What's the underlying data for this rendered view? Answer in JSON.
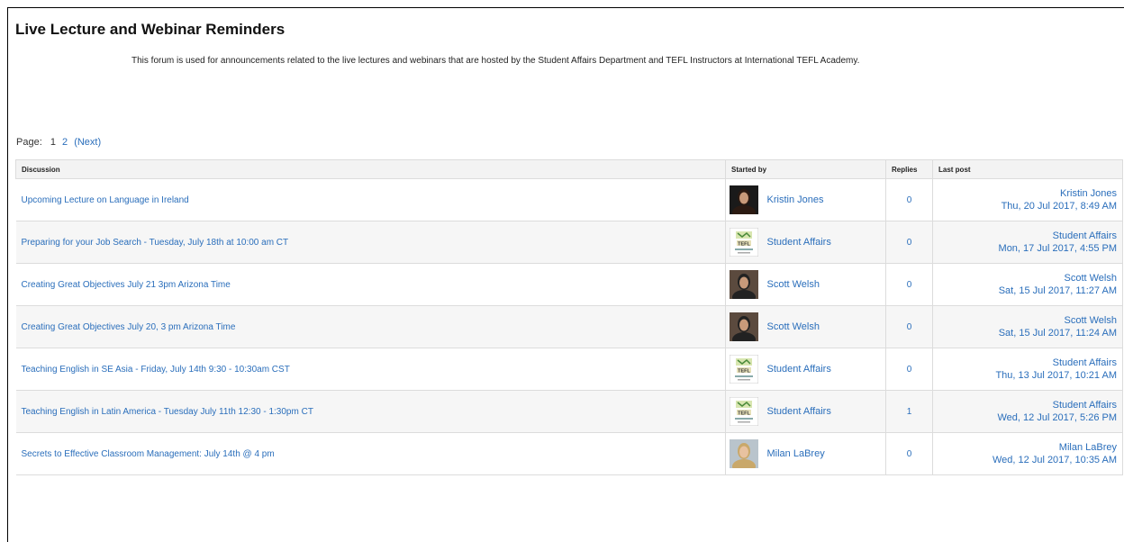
{
  "forum": {
    "title": "Live Lecture and Webinar Reminders",
    "intro": "This forum is used for announcements related to the live lectures and webinars that are hosted by the Student Affairs Department and TEFL Instructors at International TEFL Academy."
  },
  "paging": {
    "label": "Page:",
    "current": "1",
    "page2": "2",
    "next": "(Next)"
  },
  "table": {
    "headers": {
      "discussion": "Discussion",
      "started_by": "Started by",
      "replies": "Replies",
      "last_post": "Last post"
    },
    "rows": [
      {
        "topic": "Upcoming Lecture on Language in Ireland",
        "author": "Kristin Jones",
        "avatar": "photo-avatar",
        "replies": "0",
        "last_author": "Kristin Jones",
        "last_date": "Thu, 20 Jul 2017, 8:49 AM"
      },
      {
        "topic": "Preparing for your Job Search - Tuesday, July 18th at 10:00 am CT",
        "author": "Student Affairs",
        "avatar": "tefl-logo-avatar",
        "replies": "0",
        "last_author": "Student Affairs",
        "last_date": "Mon, 17 Jul 2017, 4:55 PM"
      },
      {
        "topic": "Creating Great Objectives July 21 3pm Arizona Time",
        "author": "Scott Welsh",
        "avatar": "photo-avatar",
        "replies": "0",
        "last_author": "Scott Welsh",
        "last_date": "Sat, 15 Jul 2017, 11:27 AM"
      },
      {
        "topic": "Creating Great Objectives July 20, 3 pm Arizona Time",
        "author": "Scott Welsh",
        "avatar": "photo-avatar",
        "replies": "0",
        "last_author": "Scott Welsh",
        "last_date": "Sat, 15 Jul 2017, 11:24 AM"
      },
      {
        "topic": "Teaching English in SE Asia - Friday, July 14th 9:30 - 10:30am CST",
        "author": "Student Affairs",
        "avatar": "tefl-logo-avatar",
        "replies": "0",
        "last_author": "Student Affairs",
        "last_date": "Thu, 13 Jul 2017, 10:21 AM"
      },
      {
        "topic": "Teaching English in Latin America - Tuesday July 11th 12:30 - 1:30pm CT",
        "author": "Student Affairs",
        "avatar": "tefl-logo-avatar",
        "replies": "1",
        "last_author": "Student Affairs",
        "last_date": "Wed, 12 Jul 2017, 5:26 PM"
      },
      {
        "topic": "Secrets to Effective Classroom Management: July 14th @ 4 pm",
        "author": "Milan LaBrey",
        "avatar": "photo-avatar",
        "replies": "0",
        "last_author": "Milan LaBrey",
        "last_date": "Wed, 12 Jul 2017, 10:35 AM"
      }
    ]
  },
  "colors": {
    "link": "#2a6ebb",
    "header_bg": "#f3f3f3",
    "alt_row_bg": "#f6f6f6",
    "border": "#dcdcdc"
  }
}
